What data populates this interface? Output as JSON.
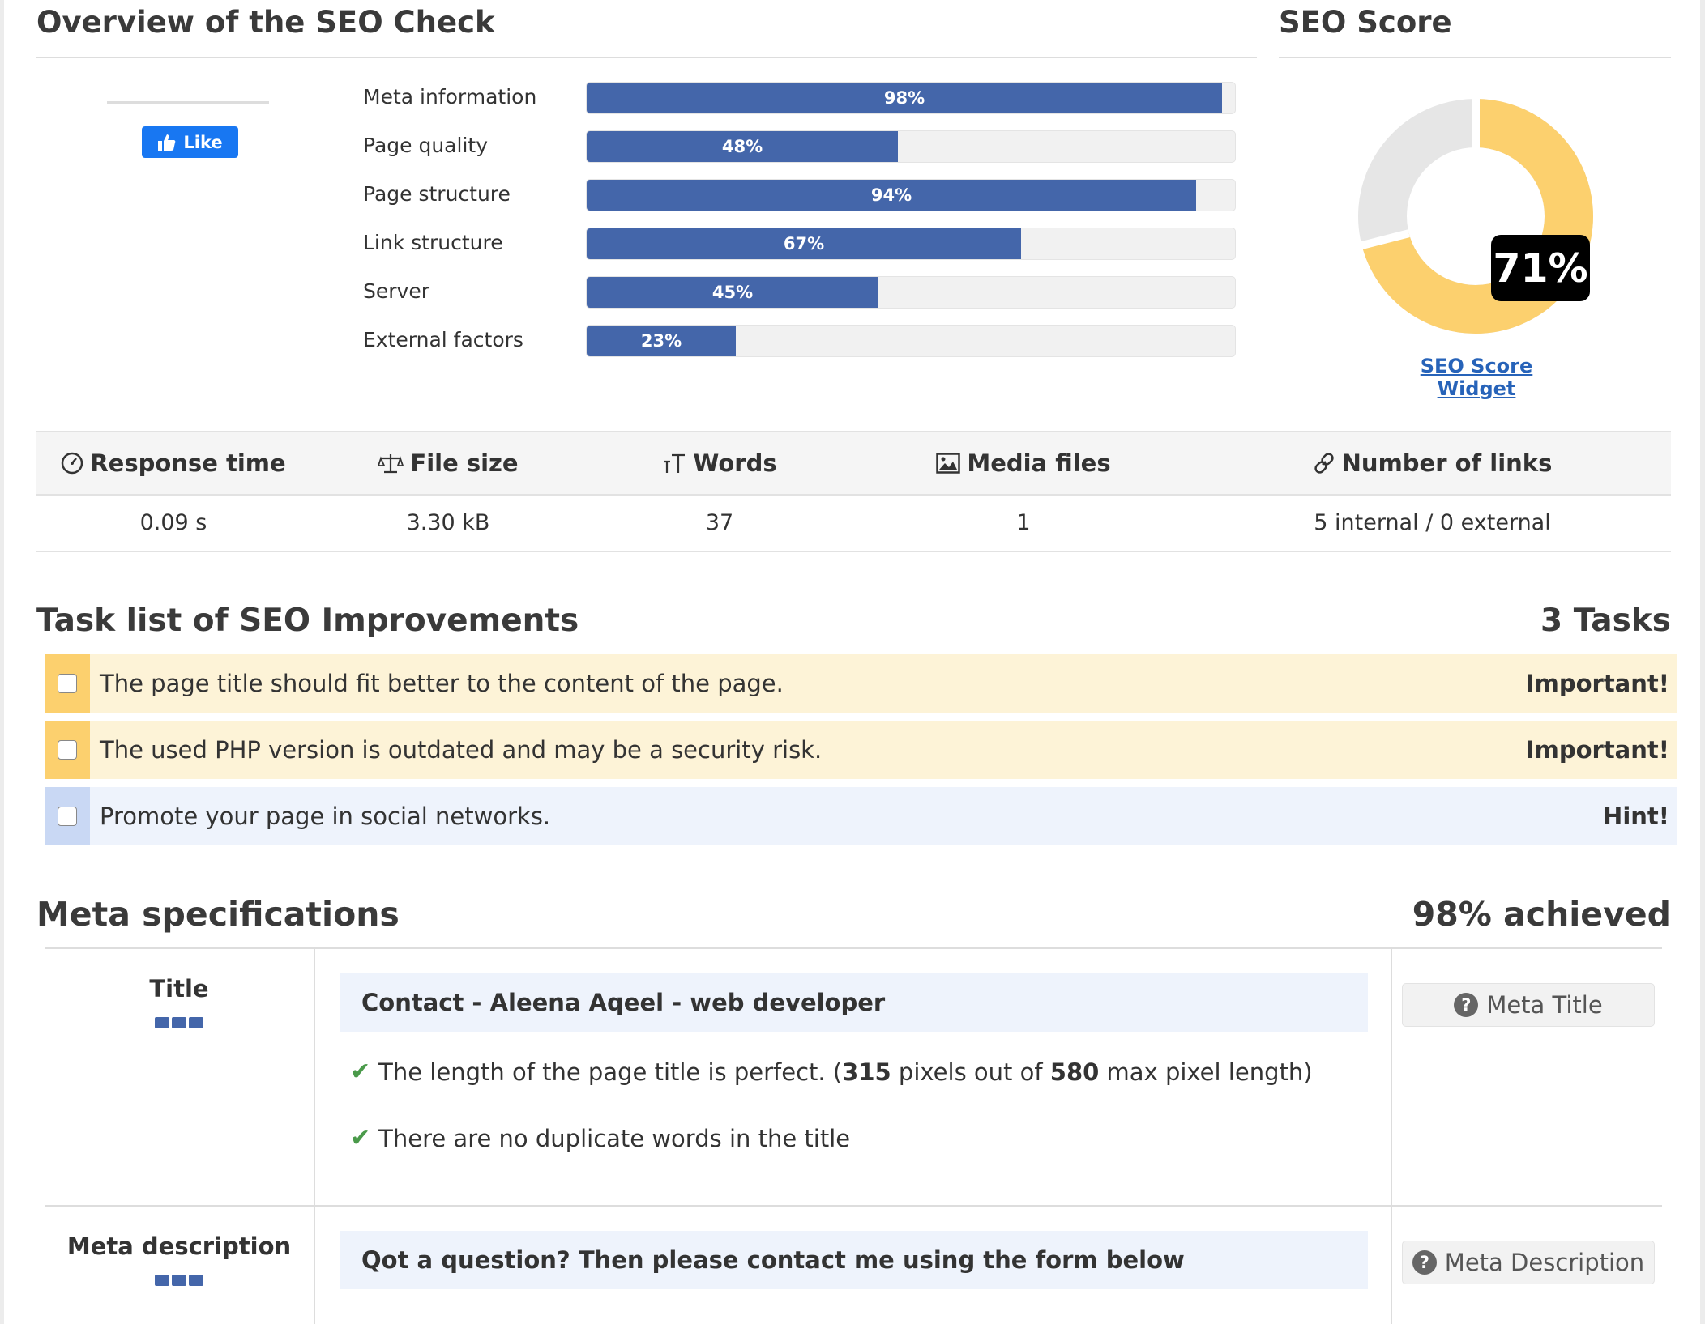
{
  "overview": {
    "title": "Overview of the SEO Check",
    "like_label": "Like",
    "categories": [
      {
        "label": "Meta information",
        "value": 98,
        "text": "98%"
      },
      {
        "label": "Page quality",
        "value": 48,
        "text": "48%"
      },
      {
        "label": "Page structure",
        "value": 94,
        "text": "94%"
      },
      {
        "label": "Link structure",
        "value": 67,
        "text": "67%"
      },
      {
        "label": "Server",
        "value": 45,
        "text": "45%"
      },
      {
        "label": "External factors",
        "value": 23,
        "text": "23%"
      }
    ],
    "bar_color": "#4466aa"
  },
  "score": {
    "title": "SEO Score",
    "value": 71,
    "text": "71%",
    "widget_link": "SEO Score Widget",
    "color": "#fcd06e",
    "remainder_color": "#e6e6e6"
  },
  "stats": [
    {
      "icon": "gauge-icon",
      "label": "Response time",
      "value": "0.09 s"
    },
    {
      "icon": "scale-icon",
      "label": "File size",
      "value": "3.30 kB"
    },
    {
      "icon": "text-icon",
      "label": "Words",
      "value": "37"
    },
    {
      "icon": "image-icon",
      "label": "Media files",
      "value": "1"
    },
    {
      "icon": "link-icon",
      "label": "Number of links",
      "value": "5 internal / 0 external"
    }
  ],
  "tasks": {
    "title": "Task list of SEO Improvements",
    "count": "3 Tasks",
    "items": [
      {
        "text": "The page title should fit better to the content of the page.",
        "level": "Important!"
      },
      {
        "text": "The used PHP version is outdated and may be a security risk.",
        "level": "Important!"
      },
      {
        "text": "Promote your page in social networks.",
        "level": "Hint!"
      }
    ]
  },
  "meta": {
    "title": "Meta specifications",
    "achieved": "98% achieved",
    "title_row": {
      "label": "Title",
      "value": "Contact - Aleena Aqeel - web developer",
      "check1_pre": "The length of the page title is perfect. (",
      "check1_num1": "315",
      "check1_mid": " pixels out of ",
      "check1_num2": "580",
      "check1_post": " max pixel length)",
      "check2": "There are no duplicate words in the title",
      "button": "Meta Title"
    },
    "desc_row": {
      "label": "Meta description",
      "value": "Qot a question? Then please contact me using the form below",
      "button": "Meta Description"
    }
  }
}
